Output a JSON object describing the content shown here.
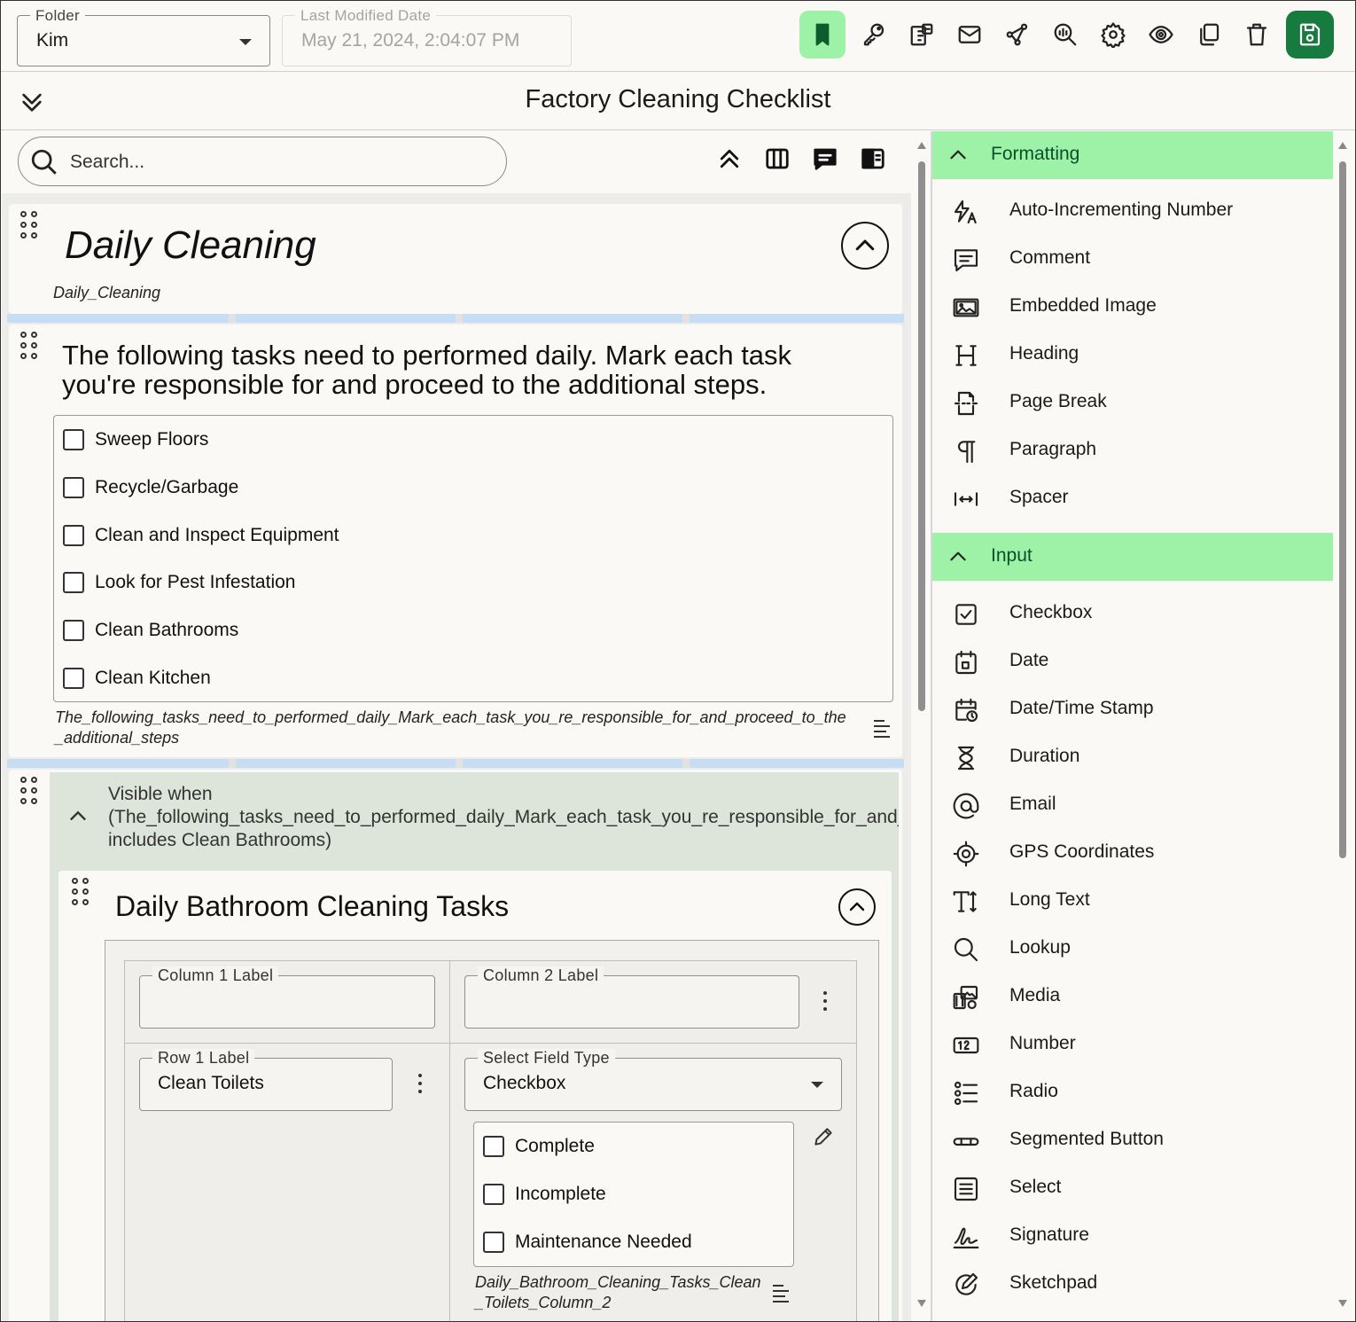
{
  "topbar": {
    "folder": {
      "label": "Folder",
      "value": "Kim"
    },
    "modified": {
      "label": "Last Modified Date",
      "value": "May 21, 2024, 2:04:07 PM"
    },
    "icons": [
      "bookmark-icon",
      "key-icon",
      "puzzle-icon",
      "mail-icon",
      "share-icon",
      "inspect-icon",
      "gear-icon",
      "eye-icon",
      "copy-icon",
      "trash-icon",
      "save-icon"
    ],
    "accent": "#9ef2a8",
    "save_color": "#177a3e"
  },
  "header": {
    "title": "Factory Cleaning Checklist"
  },
  "search": {
    "placeholder": "Search..."
  },
  "sections": {
    "daily": {
      "heading": "Daily Cleaning",
      "var": "Daily_Cleaning"
    },
    "tasks": {
      "prompt_line1": "The following tasks need to performed daily. Mark each task",
      "prompt_line2": "you're responsible for and proceed to the additional steps.",
      "options": [
        "Sweep Floors",
        "Recycle/Garbage",
        "Clean and Inspect Equipment",
        "Look for Pest Infestation",
        "Clean Bathrooms",
        "Clean Kitchen"
      ],
      "var_line1": "The_following_tasks_need_to_performed_daily_Mark_each_task_you_re_responsible_for_and_proceed_to_the",
      "var_line2": "_additional_steps"
    },
    "condition": {
      "line1": "Visible when",
      "line2": "(The_following_tasks_need_to_performed_daily_Mark_each_task_you_re_responsible_for_and_proceed_to_the_additional_steps",
      "line3": "includes Clean Bathrooms)"
    },
    "bathroom": {
      "heading": "Daily Bathroom Cleaning Tasks",
      "col1_label": "Column 1 Label",
      "col2_label": "Column 2 Label",
      "row1_label": "Row 1 Label",
      "row1_value": "Clean Toilets",
      "field_type_label": "Select Field Type",
      "field_type_value": "Checkbox",
      "options": [
        "Complete",
        "Incomplete",
        "Maintenance Needed"
      ],
      "var_line1": "Daily_Bathroom_Cleaning_Tasks_Clean",
      "var_line2": "_Toilets_Column_2"
    }
  },
  "palette": {
    "formatting": {
      "label": "Formatting",
      "items": [
        {
          "label": "Auto-Incrementing Number",
          "icon": "auto-number-icon"
        },
        {
          "label": "Comment",
          "icon": "comment-icon"
        },
        {
          "label": "Embedded Image",
          "icon": "image-icon"
        },
        {
          "label": "Heading",
          "icon": "heading-icon"
        },
        {
          "label": "Page Break",
          "icon": "page-break-icon"
        },
        {
          "label": "Paragraph",
          "icon": "paragraph-icon"
        },
        {
          "label": "Spacer",
          "icon": "spacer-icon"
        }
      ]
    },
    "input": {
      "label": "Input",
      "items": [
        {
          "label": "Checkbox",
          "icon": "checkbox-icon"
        },
        {
          "label": "Date",
          "icon": "calendar-icon"
        },
        {
          "label": "Date/Time Stamp",
          "icon": "datetime-icon"
        },
        {
          "label": "Duration",
          "icon": "hourglass-icon"
        },
        {
          "label": "Email",
          "icon": "at-icon"
        },
        {
          "label": "GPS Coordinates",
          "icon": "gps-icon"
        },
        {
          "label": "Long Text",
          "icon": "long-text-icon"
        },
        {
          "label": "Lookup",
          "icon": "lookup-icon"
        },
        {
          "label": "Media",
          "icon": "media-icon"
        },
        {
          "label": "Number",
          "icon": "number-icon"
        },
        {
          "label": "Radio",
          "icon": "radio-list-icon"
        },
        {
          "label": "Segmented Button",
          "icon": "segmented-icon"
        },
        {
          "label": "Select",
          "icon": "select-icon"
        },
        {
          "label": "Signature",
          "icon": "signature-icon"
        },
        {
          "label": "Sketchpad",
          "icon": "sketchpad-icon"
        }
      ]
    }
  }
}
